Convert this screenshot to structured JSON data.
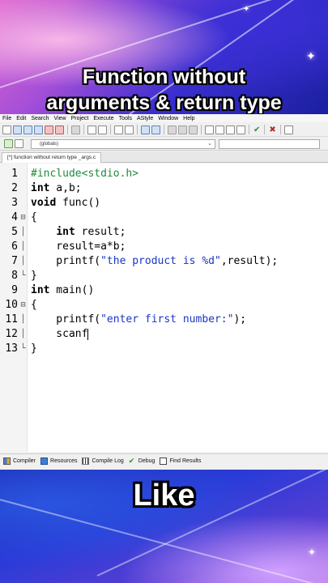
{
  "overlay": {
    "headline_line1": "Function without",
    "headline_line2": "arguments & return type",
    "bottom_text": "Like"
  },
  "menu": [
    "File",
    "Edit",
    "Search",
    "View",
    "Project",
    "Execute",
    "Tools",
    "AStyle",
    "Window",
    "Help"
  ],
  "scope_dropdown": {
    "value": "(globals)"
  },
  "editor_tab": {
    "label": "[*] function without return type _args.c"
  },
  "code_lines": [
    {
      "n": "1",
      "fold": "",
      "html": "<span class=\"pp\">#include&lt;stdio.h&gt;</span>"
    },
    {
      "n": "2",
      "fold": "",
      "html": "<span class=\"kw\">int</span> a,b;"
    },
    {
      "n": "3",
      "fold": "",
      "html": "<span class=\"kw\">void</span> func()"
    },
    {
      "n": "4",
      "fold": "⊟",
      "html": "{"
    },
    {
      "n": "5",
      "fold": "│",
      "html": "    <span class=\"kw\">int</span> result;"
    },
    {
      "n": "6",
      "fold": "│",
      "html": "    result=a*b;"
    },
    {
      "n": "7",
      "fold": "│",
      "html": "    printf(<span class=\"str\">\"the product is %d\"</span>,result);"
    },
    {
      "n": "8",
      "fold": "└",
      "html": "}"
    },
    {
      "n": "9",
      "fold": "",
      "html": "<span class=\"kw\">int</span> main()"
    },
    {
      "n": "10",
      "fold": "⊟",
      "html": "{"
    },
    {
      "n": "11",
      "fold": "│",
      "html": "    printf(<span class=\"str\">\"enter first number:\"</span>);"
    },
    {
      "n": "12",
      "fold": "│",
      "html": "    scanf<span class=\"caret-bar\"></span>"
    },
    {
      "n": "13",
      "fold": "└",
      "html": "}"
    }
  ],
  "statusbar": {
    "compiler": "Compiler",
    "resources": "Resources",
    "compile_log": "Compile Log",
    "debug": "Debug",
    "find_results": "Find Results"
  }
}
